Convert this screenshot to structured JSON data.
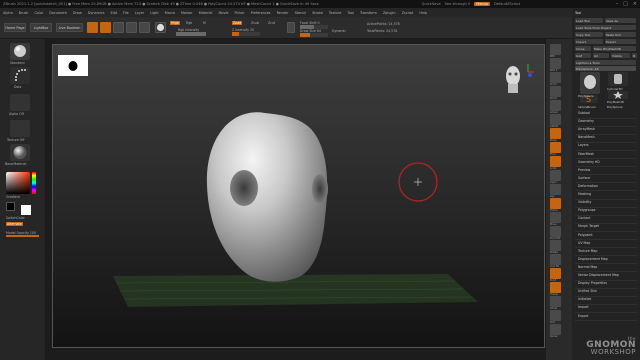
{
  "titlebar": {
    "text": "ZBrush 2021.1.2 [quicksketch_001]  ● Free Mem 25.89GB ● Active Mem 713 ● Scratch Disk 49 ● ZTime 0.046 ● PolyCount 24.574 KP ● MeshCount 1 ● QuickSave In 49 Secs",
    "menu_label": "Menus",
    "quicksave_label": "QuickSave",
    "see_through_label": "See-through 0",
    "script_label": "DefaultZScript"
  },
  "menubar": [
    "Alpha",
    "Brush",
    "Color",
    "Document",
    "Draw",
    "Dynamics",
    "Edit",
    "File",
    "Layer",
    "Light",
    "Macro",
    "Marker",
    "Material",
    "Movie",
    "Picker",
    "Preferences",
    "Render",
    "Stencil",
    "Stroke",
    "Texture",
    "Tool",
    "Transform",
    "Zplugin",
    "Zscript",
    "Help"
  ],
  "shelf": {
    "home_page": "Home Page",
    "lightbox": "LightBox",
    "live_boolean": "Live Boolean",
    "edit": "Edit",
    "draw": "Draw",
    "move": "Move",
    "scale": "Scale",
    "rotate": "Rotate",
    "mrgb": "Mrgb",
    "rgb": "Rgb",
    "m_label": "M",
    "rgb_intensity": "Rgb Intensity",
    "zadd": "Zadd",
    "zsub": "Zsub",
    "zcut": "Zcut",
    "z_intensity": "Z Intensity 25",
    "focal_shift": "Focal Shift 0",
    "draw_size": "Draw Size 64",
    "dynamic": "Dynamic",
    "active_points": "ActivePoints: 24,578",
    "total_points": "TotalPoints: 24,578"
  },
  "leftpanel": {
    "brush_label": "Standard",
    "stroke_label": "Dots",
    "alpha_label": "Alpha Off",
    "texture_label": "Texture Off",
    "material_label": "BasicMaterial",
    "gradient_label": "Gradient",
    "switch_color": "SwitchColor",
    "alternate": "Alternate",
    "model_opacity": "Model Opacity 100"
  },
  "rtools": [
    "BPR",
    "SPix 3",
    "Scroll",
    "Zoom",
    "Actual",
    "AAHalf",
    "Persp",
    "Floor",
    "Local",
    "LSym",
    "Gyz",
    "Frame",
    "Move",
    "Zoom3D",
    "Rotate",
    "Line Fill",
    "PolyF",
    "Transp",
    "Ghost",
    "Solo",
    "Xpose"
  ],
  "rpanel": {
    "title": "Tool",
    "load_tool": "Load Tool",
    "save_as": "Save As",
    "load_from_project": "Load Tools From Project",
    "copy_tool": "Copy Tool",
    "paste_tool": "Paste Tool",
    "import": "Import",
    "export": "Export",
    "clone": "Clone",
    "make_polymesh": "Make PolyMesh3D",
    "goz": "GoZ",
    "all": "All",
    "visible": "Visible",
    "r_label": "R",
    "lightbox_tools": "Lightbox ▸ Tools",
    "polysphere": "PolySphere: 48",
    "tool_thumbs": [
      "PolySphere",
      "Cylinder3D",
      "PolyMesh3D",
      "SimpleBrush",
      "PolySphere"
    ],
    "sections": [
      "Subtool",
      "Geometry",
      "ArrayMesh",
      "NanoMesh",
      "Layers",
      "FiberMesh",
      "Geometry HD",
      "Preview",
      "Surface",
      "Deformation",
      "Masking",
      "Visibility",
      "Polygroups",
      "Contact",
      "Morph Target",
      "Polypaint",
      "UV Map",
      "Texture Map",
      "Displacement Map",
      "Normal Map",
      "Vector Displacement Map",
      "Display Properties",
      "Unified Skin",
      "Initialize",
      "Import",
      "Export"
    ]
  },
  "watermark": {
    "line1": "the",
    "line2": "GNOMON",
    "line3": "WORKSHOP"
  },
  "colors": {
    "accent": "#c46512",
    "cursor_ring": "#b32222",
    "floor_grid": "#3d6b34"
  }
}
